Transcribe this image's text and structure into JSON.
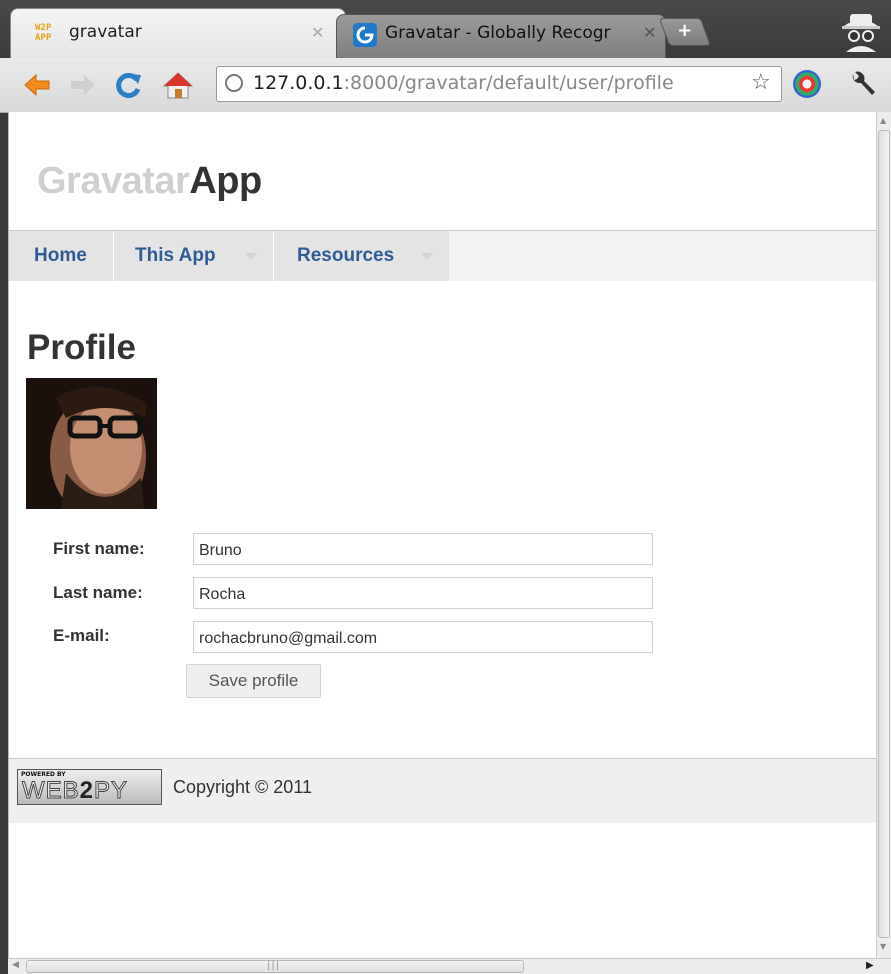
{
  "browser": {
    "tabs": [
      {
        "title": "gravatar",
        "favicon": "w2p-app-icon",
        "favicon_text": "W2P APP",
        "active": true
      },
      {
        "title": "Gravatar - Globally Recogr",
        "favicon": "gravatar-icon",
        "active": false
      }
    ],
    "address": {
      "host": "127.0.0.1",
      "path": ":8000/gravatar/default/user/profile"
    }
  },
  "site": {
    "logo": {
      "part1": "Gravatar",
      "part2": "App"
    },
    "menu": [
      {
        "label": "Home"
      },
      {
        "label": "This App"
      },
      {
        "label": "Resources"
      }
    ]
  },
  "profile": {
    "title": "Profile",
    "fields": [
      {
        "label": "First name:",
        "value": "Bruno"
      },
      {
        "label": "Last name:",
        "value": "Rocha"
      },
      {
        "label": "E-mail:",
        "value": "rochacbruno@gmail.com"
      }
    ],
    "save_label": "Save profile"
  },
  "footer": {
    "badge": {
      "powered": "POWERED BY",
      "brand_a": "WEB",
      "brand_b": "2",
      "brand_c": "PY"
    },
    "copyright": "Copyright © 2011"
  },
  "colors": {
    "menu_link": "#2f5d93",
    "logo_light": "#cfcfcf",
    "logo_dark": "#333333"
  }
}
